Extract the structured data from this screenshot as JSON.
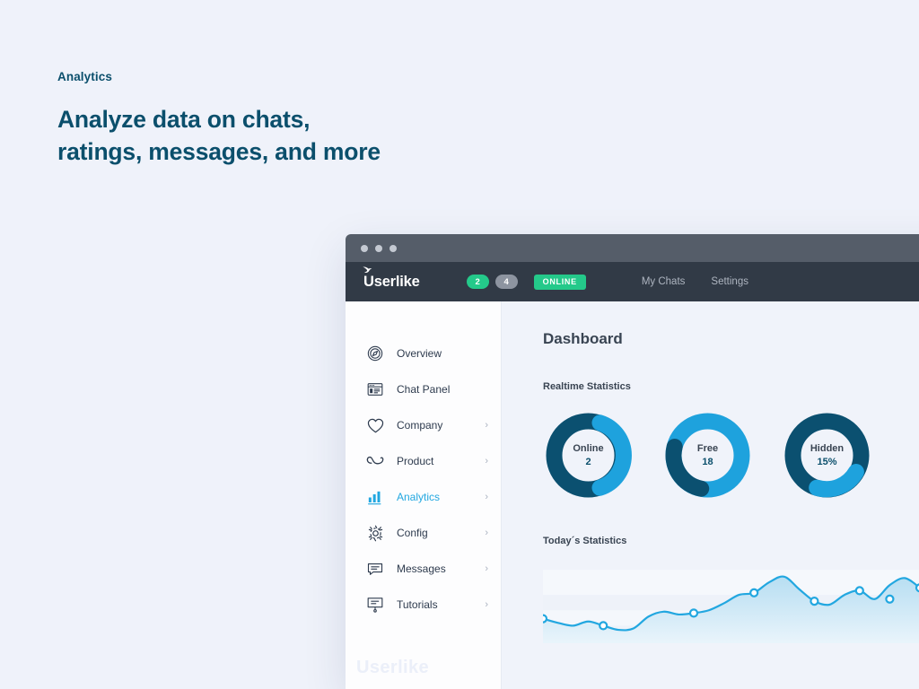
{
  "hero": {
    "eyebrow": "Analytics",
    "title_line1": "Analyze data on chats,",
    "title_line2": "ratings, messages, and more"
  },
  "colors": {
    "page_background": "#eff2fa",
    "brand_dark_blue": "#0b4f6c",
    "accent_blue": "#22a7e0",
    "donut_dark": "#0b5070",
    "donut_light": "#1ea2dd",
    "appbar": "#313a46",
    "titlebar": "#555d69",
    "status_green": "#24c98a",
    "badge_gray": "#8d94a0"
  },
  "window": {
    "titlebar": {
      "dots": [
        "window-dot",
        "window-dot",
        "window-dot"
      ]
    },
    "appbar": {
      "logo_text": "Userlike",
      "logo_mark": "bird-icon",
      "badges": [
        {
          "label": "2",
          "style": "green"
        },
        {
          "label": "4",
          "style": "gray"
        }
      ],
      "status": "ONLINE",
      "nav": [
        {
          "label": "My Chats"
        },
        {
          "label": "Settings"
        }
      ]
    },
    "sidebar": {
      "items": [
        {
          "label": "Overview",
          "icon": "compass-icon",
          "chevron": "",
          "active": false
        },
        {
          "label": "Chat Panel",
          "icon": "browser-icon",
          "chevron": "",
          "active": false
        },
        {
          "label": "Company",
          "icon": "heart-icon",
          "chevron": "›",
          "active": false
        },
        {
          "label": "Product",
          "icon": "ribbon-icon",
          "chevron": "›",
          "active": false
        },
        {
          "label": "Analytics",
          "icon": "bar-chart-icon",
          "chevron": "›",
          "active": true
        },
        {
          "label": "Config",
          "icon": "gear-icon",
          "chevron": "›",
          "active": false
        },
        {
          "label": "Messages",
          "icon": "message-icon",
          "chevron": "›",
          "active": false
        },
        {
          "label": "Tutorials",
          "icon": "easel-icon",
          "chevron": "›",
          "active": false
        }
      ],
      "watermark": "Userlike"
    },
    "content": {
      "page_title": "Dashboard",
      "realtime_title": "Realtime Statistics",
      "today_title": "Today´s Statistics"
    }
  },
  "chart_data": [
    {
      "type": "pie",
      "title": "Online",
      "center_label": "Online",
      "center_value": "2",
      "slices": [
        {
          "name": "filled",
          "percent": 39,
          "color": "#1ea2dd",
          "start_deg": 20
        },
        {
          "name": "remainder",
          "percent": 61,
          "color": "#0b5070",
          "start_deg": 160
        }
      ]
    },
    {
      "type": "pie",
      "title": "Free",
      "center_label": "Free",
      "center_value": "18",
      "slices": [
        {
          "name": "filled",
          "percent": 82,
          "color": "#1ea2dd",
          "start_deg": 255
        },
        {
          "name": "remainder",
          "percent": 18,
          "color": "#0b5070",
          "start_deg": 190
        }
      ]
    },
    {
      "type": "pie",
      "title": "Hidden",
      "center_label": "Hidden",
      "center_value": "15%",
      "slices": [
        {
          "name": "filled",
          "percent": 15,
          "color": "#1ea2dd",
          "start_deg": 150
        },
        {
          "name": "remainder",
          "percent": 85,
          "color": "#0b5070",
          "start_deg": 205
        }
      ]
    },
    {
      "type": "area",
      "title": "Today´s Statistics",
      "xlabel": "",
      "ylabel": "",
      "grid": true,
      "legend": "none",
      "ylim": [
        0,
        100
      ],
      "line_color": "#22a7e0",
      "fill_top": "#bfe2f4",
      "fill_bottom": "#eaf5fb",
      "x": [
        0,
        4,
        8,
        12,
        16,
        20,
        24,
        28,
        32,
        36,
        40,
        44,
        48,
        52,
        56,
        60,
        64,
        68,
        72,
        76,
        80,
        84,
        88,
        92,
        96,
        100
      ],
      "y": [
        30,
        24,
        20,
        26,
        20,
        14,
        16,
        33,
        40,
        36,
        38,
        42,
        52,
        64,
        67,
        82,
        90,
        72,
        55,
        50,
        64,
        70,
        58,
        78,
        88,
        74
      ],
      "markers": [
        {
          "x": 0,
          "y": 30
        },
        {
          "x": 16,
          "y": 20
        },
        {
          "x": 40,
          "y": 38
        },
        {
          "x": 56,
          "y": 67
        },
        {
          "x": 72,
          "y": 55
        },
        {
          "x": 84,
          "y": 70
        },
        {
          "x": 92,
          "y": 58
        },
        {
          "x": 100,
          "y": 74
        }
      ]
    }
  ]
}
